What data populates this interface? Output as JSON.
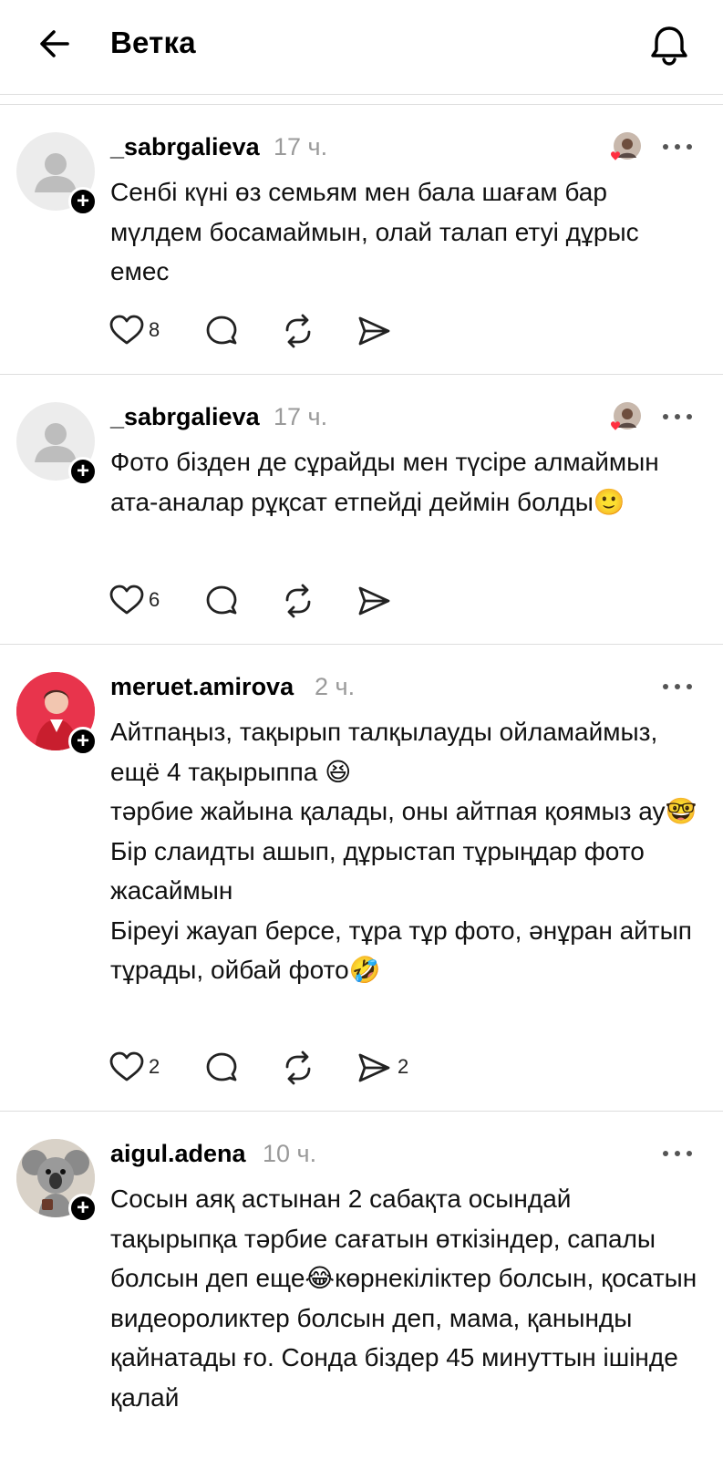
{
  "header": {
    "title": "Ветка"
  },
  "posts": [
    {
      "username": "_sabrgalieva",
      "time": "17 ч.",
      "text": "Сенбі күні өз семьям мен бала шағам бар мүлдем босамаймын, олай талап етуі дұрыс емес",
      "likes": "8",
      "reposts": "",
      "shares": ""
    },
    {
      "username": "_sabrgalieva",
      "time": "17 ч.",
      "text": "Фото бізден де сұрайды мен түсіре алмаймын ата-аналар рұқсат етпейді деймін болды🙂",
      "likes": "6",
      "reposts": "",
      "shares": ""
    },
    {
      "username": "meruet.amirova",
      "time": "2 ч.",
      "text": "Айтпаңыз, тақырып талқылауды ойламаймыз, ещё 4 тақырыппа 😆\nтәрбие жайына қалады, оны айтпая қоямыз ау🤓\nБір слаидты ашып, дұрыстап тұрыңдар фото жасаймын\nБіреуі жауап берсе, тұра тұр фото, әнұран айтып тұрады, ойбай фото🤣",
      "likes": "2",
      "reposts": "",
      "shares": "2"
    },
    {
      "username": "aigul.adena",
      "time": "10 ч.",
      "text": "Сосын аяқ астынан 2 сабақта осындай тақырыпқа тәрбие сағатын өткізіндер, сапалы болсын деп еще😂көрнекіліктер болсын, қосатын видеороликтер болсын деп, мама, қанынды қайнатады ғо. Сонда біздер 45 минуттын ішінде қалай",
      "likes": "",
      "reposts": "",
      "shares": ""
    }
  ],
  "icons": {
    "back": "arrow-left-icon",
    "bell": "bell-icon",
    "like": "heart-icon",
    "comment": "comment-bubble-icon",
    "repost": "repost-icon",
    "share": "send-icon",
    "more": "more-dots-icon",
    "follow": "plus-icon"
  },
  "colors": {
    "accent": "#000000",
    "time": "#9a9a9a",
    "divider": "#dddddd",
    "like_heart": "#ff3040"
  }
}
